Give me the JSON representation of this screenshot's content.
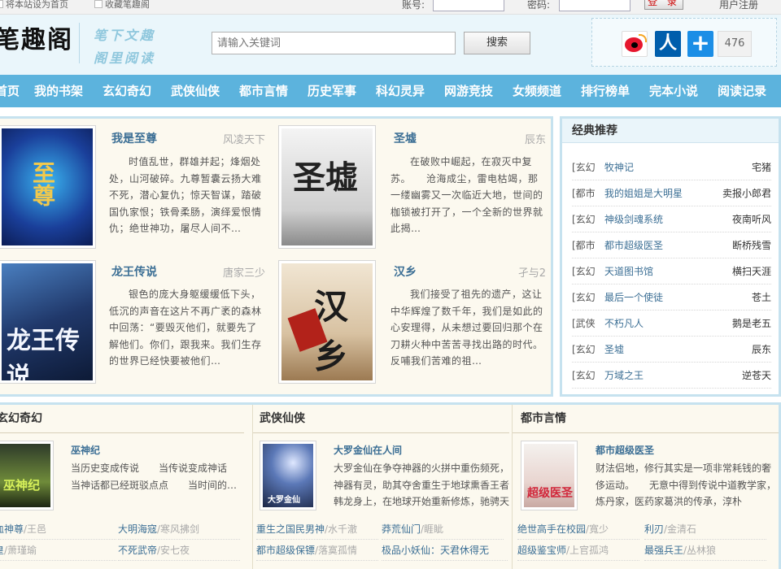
{
  "topbar": {
    "set_homepage": "将本站设为首页",
    "bookmark": "收藏笔趣阁",
    "account_label": "账号:",
    "password_label": "密码:",
    "login_button": "登 录",
    "register": "用户注册"
  },
  "header": {
    "logo": "笔趣阁",
    "slogan_1": "笔下文趣",
    "slogan_2": "阁里阅读",
    "search_placeholder": "请输入关键词",
    "search_button": "搜索",
    "share_count": "476",
    "share_icons": [
      "weibo-icon",
      "renren-icon",
      "plus-share-icon"
    ]
  },
  "nav": [
    "首页",
    "我的书架",
    "玄幻奇幻",
    "武侠仙侠",
    "都市言情",
    "历史军事",
    "科幻灵异",
    "网游竞技",
    "女频频道",
    "排行榜单",
    "完本小说",
    "阅读记录"
  ],
  "featured": [
    {
      "title": "我是至尊",
      "author": "风凌天下",
      "desc": "时值乱世，群雄并起；烽烟处处，山河破碎。九尊暂囊云扬大难不死，潜心复仇；惊天智谋，踏破国仇家恨；铁骨柔肠，演绎爱恨情仇；绝世神功，屠尽人间不…"
    },
    {
      "title": "圣墟",
      "author": "辰东",
      "desc": "在破败中崛起，在寂灭中复苏。　　沧海成尘，雷电枯竭，那一缕幽雾又一次临近大地，世间的枷锁被打开了，一个全新的世界就此揭…"
    },
    {
      "title": "龙王传说",
      "author": "唐家三少",
      "desc": "银色的庞大身躯缓缓低下头，低沉的声音在这片不再广袤的森林中回荡：“要毁灭他们，就要先了解他们。你们，跟我来。我们生存的世界已经快要被他们…"
    },
    {
      "title": "汉乡",
      "author": "孑与2",
      "desc": "我们接受了祖先的遗产，这让中华辉煌了数千年，我们是如此的心安理得，从未想过要回归那个在刀耕火种中苦苦寻找出路的时代。反哺我们苦难的祖…"
    }
  ],
  "recommend": {
    "heading": "经典推荐",
    "rows": [
      {
        "cat": "[玄幻",
        "name": "牧神记",
        "author": "宅猪"
      },
      {
        "cat": "[都市",
        "name": "我的姐姐是大明星",
        "author": "卖报小郎君"
      },
      {
        "cat": "[玄幻",
        "name": "神级剑魂系统",
        "author": "夜南听风"
      },
      {
        "cat": "[都市",
        "name": "都市超级医圣",
        "author": "断桥残雪"
      },
      {
        "cat": "[玄幻",
        "name": "天道图书馆",
        "author": "横扫天涯"
      },
      {
        "cat": "[玄幻",
        "name": "最后一个使徒",
        "author": "苍土"
      },
      {
        "cat": "[武侠",
        "name": "不朽凡人",
        "author": "鹅是老五"
      },
      {
        "cat": "[玄幻",
        "name": "圣墟",
        "author": "辰东"
      },
      {
        "cat": "[玄幻",
        "name": "万域之王",
        "author": "逆苍天"
      }
    ]
  },
  "categories": [
    {
      "heading": "玄幻奇幻",
      "book_title": "巫神纪",
      "book_desc": "当历史变成传说　　当传说变成神话　　当神话都已经斑驳点点　　当时间的…",
      "list": [
        [
          {
            "name": "血神尊",
            "author": "/王邑"
          },
          {
            "name": "大明海寇",
            "author": "/寒风拂剑"
          }
        ],
        [
          {
            "name": "皇",
            "author": "/萧瑾瑜"
          },
          {
            "name": "不死武帝",
            "author": "/安七夜"
          }
        ]
      ]
    },
    {
      "heading": "武侠仙侠",
      "book_title": "大罗金仙在人间",
      "book_desc": "大罗金仙在争夺神器的火拼中重伤频死，神器有灵，助其夺舍重生于地球熏香王者韩龙身上，在地球开始重新修炼，驰骋天",
      "list": [
        [
          {
            "name": "重生之国民男神",
            "author": "/水千澈"
          },
          {
            "name": "莽荒仙门",
            "author": "/睚眦"
          }
        ],
        [
          {
            "name": "都市超级保镖",
            "author": "/落寞孤情"
          },
          {
            "name": "极品小妖仙：天君休得无",
            "author": ""
          }
        ]
      ]
    },
    {
      "heading": "都市言情",
      "book_title": "都市超级医圣",
      "book_desc": "财法侣地，修行其实是一项非常耗钱的奢侈运动。　　无意中得到传说中道教学家，炼丹家，医药家葛洪的传承，淳朴",
      "list": [
        [
          {
            "name": "绝世高手在校园",
            "author": "/寬少"
          },
          {
            "name": "利刃",
            "author": "/金清石"
          }
        ],
        [
          {
            "name": "超级鉴宝师",
            "author": "/上官孤鸿"
          },
          {
            "name": "最强兵王",
            "author": "/丛林狼"
          }
        ]
      ]
    }
  ]
}
